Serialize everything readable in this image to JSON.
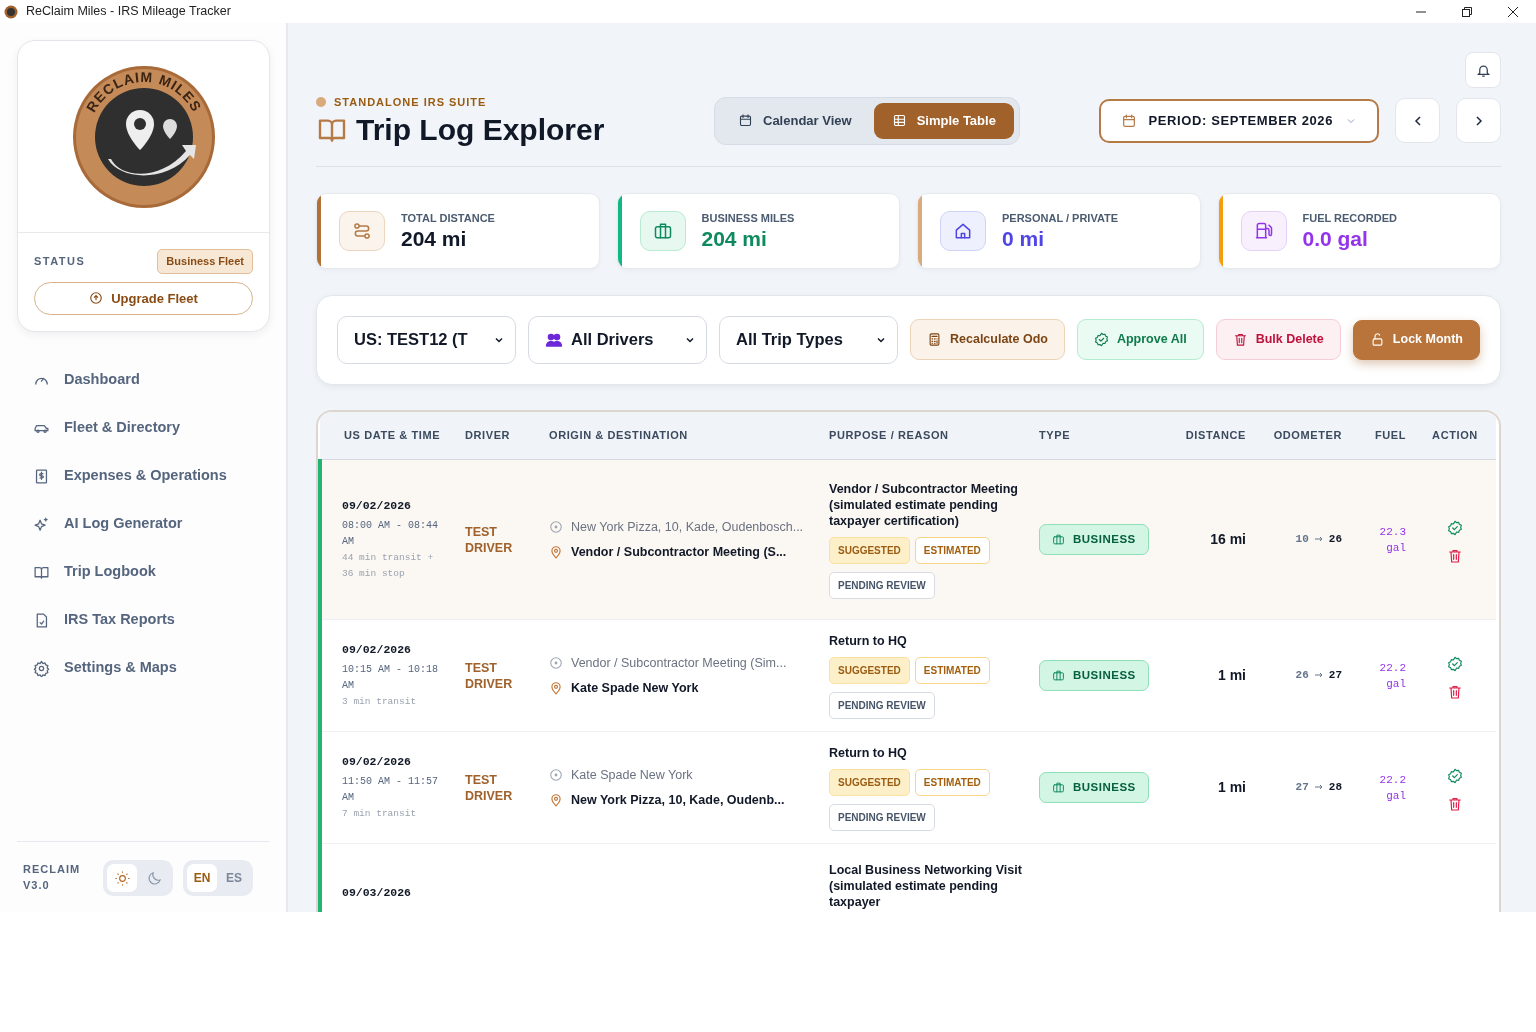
{
  "window": {
    "title": "ReClaim Miles - IRS Mileage Tracker"
  },
  "sidebar": {
    "logo_text": "RECLAIM MILES",
    "status_label": "STATUS",
    "plan": "Business Fleet",
    "upgrade_button": "Upgrade Fleet",
    "nav": [
      {
        "label": "Dashboard",
        "kind": "gauge",
        "selected": false
      },
      {
        "label": "Fleet & Directory",
        "kind": "car",
        "selected": false
      },
      {
        "label": "Expenses & Operations",
        "kind": "receipt",
        "selected": false
      },
      {
        "label": "AI Log Generator",
        "kind": "sparkle",
        "selected": false
      },
      {
        "label": "Trip Logbook",
        "kind": "book",
        "selected": false
      },
      {
        "label": "IRS Tax Reports",
        "kind": "report",
        "selected": false
      },
      {
        "label": "Settings & Maps",
        "kind": "gear",
        "selected": false
      }
    ],
    "version": "RECLAIM V3.0",
    "themes": [
      {
        "kind": "light",
        "selected": true
      },
      {
        "kind": "dark",
        "selected": false
      }
    ],
    "languages": [
      {
        "label": "EN",
        "selected": true
      },
      {
        "label": "ES",
        "selected": false
      }
    ]
  },
  "header": {
    "eyebrow": "STANDALONE IRS SUITE",
    "title": "Trip Log Explorer",
    "views": [
      {
        "label": "Calendar View",
        "kind": "calendar",
        "selected": false
      },
      {
        "label": "Simple Table",
        "kind": "table",
        "selected": true
      }
    ],
    "period": "PERIOD: SEPTEMBER 2026"
  },
  "stats": [
    {
      "label": "TOTAL DISTANCE",
      "value": "204 mi",
      "kind": "route",
      "color": "#b07138"
    },
    {
      "label": "BUSINESS MILES",
      "value": "204 mi",
      "kind": "briefcase",
      "color": "#10b981"
    },
    {
      "label": "PERSONAL / PRIVATE",
      "value": "0 mi",
      "kind": "home",
      "color": "#d9aa7c"
    },
    {
      "label": "FUEL RECORDED",
      "value": "0.0 gal",
      "kind": "fuel",
      "color": "#f59e0b"
    }
  ],
  "filters": [
    {
      "value": "US: TEST12 (T",
      "kind": "plain"
    },
    {
      "value": "All Drivers",
      "kind": "people"
    },
    {
      "value": "All Trip Types",
      "kind": "plain"
    }
  ],
  "actions": [
    {
      "label": "Recalculate Odo",
      "kind": "recalc"
    },
    {
      "label": "Approve All",
      "kind": "approve"
    },
    {
      "label": "Bulk Delete",
      "kind": "delete"
    },
    {
      "label": "Lock Month",
      "kind": "lock"
    }
  ],
  "table": {
    "columns": [
      "US DATE & TIME",
      "DRIVER",
      "ORIGIN & DESTINATION",
      "PURPOSE / REASON",
      "TYPE",
      "DISTANCE",
      "ODOMETER",
      "FUEL",
      "ACTION"
    ],
    "rows": [
      {
        "selected": true,
        "date": "09/02/2026",
        "time": "08:00 AM - 08:44 AM",
        "duration": "44 min transit + 36 min stop",
        "driver": "TEST DRIVER",
        "origin": "New York Pizza, 10, Kade, Oudenbosch...",
        "destination": "Vendor / Subcontractor Meeting (S...",
        "purpose": "Vendor / Subcontractor Meeting (simulated estimate pending taxpayer certification)",
        "tags": [
          {
            "label": "SUGGESTED",
            "kind": "suggested"
          },
          {
            "label": "ESTIMATED",
            "kind": "estimated"
          },
          {
            "label": "PENDING REVIEW",
            "kind": "pending"
          }
        ],
        "type": "BUSINESS",
        "distance": "16 mi",
        "odo_from": "10",
        "odo_to": "26",
        "fuel": "22.3 gal"
      },
      {
        "selected": false,
        "date": "09/02/2026",
        "time": "10:15 AM - 10:18 AM",
        "duration": "3 min transit",
        "driver": "TEST DRIVER",
        "origin": "Vendor / Subcontractor Meeting (Sim...",
        "destination": "Kate Spade New York",
        "purpose": "Return to HQ",
        "tags": [
          {
            "label": "SUGGESTED",
            "kind": "suggested"
          },
          {
            "label": "ESTIMATED",
            "kind": "estimated"
          },
          {
            "label": "PENDING REVIEW",
            "kind": "pending"
          }
        ],
        "type": "BUSINESS",
        "distance": "1 mi",
        "odo_from": "26",
        "odo_to": "27",
        "fuel": "22.2 gal"
      },
      {
        "selected": false,
        "date": "09/02/2026",
        "time": "11:50 AM - 11:57 AM",
        "duration": "7 min transit",
        "driver": "TEST DRIVER",
        "origin": "Kate Spade New York",
        "destination": "New York Pizza, 10, Kade, Oudenb...",
        "purpose": "Return to HQ",
        "tags": [
          {
            "label": "SUGGESTED",
            "kind": "suggested"
          },
          {
            "label": "ESTIMATED",
            "kind": "estimated"
          },
          {
            "label": "PENDING REVIEW",
            "kind": "pending"
          }
        ],
        "type": "BUSINESS",
        "distance": "1 mi",
        "odo_from": "27",
        "odo_to": "28",
        "fuel": "22.2 gal"
      },
      {
        "selected": false,
        "date": "09/03/2026",
        "purpose": "Local Business Networking Visit (simulated estimate pending taxpayer"
      }
    ]
  }
}
